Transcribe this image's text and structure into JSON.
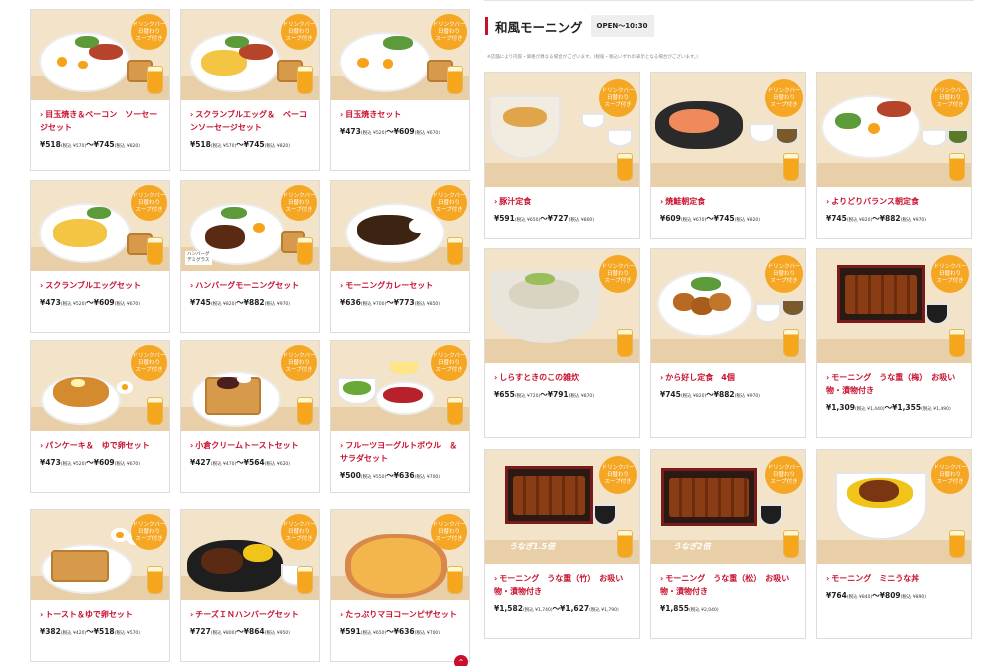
{
  "section": {
    "title": "和風モーニング",
    "hours": "OPEN〜10:30",
    "note": "※店舗により内容・価格が異なる場合がございます。(税抜・税込いずれの表示となる場合がございます。)"
  },
  "badge_text": "ドリンクバー\n日替わり\nスープ付き",
  "arrow": "›",
  "left_menu": [
    {
      "name": "目玉焼き＆ベーコン　ソーセージセット",
      "price": "¥518",
      "price_tax": "(税込 ¥570)",
      "sep": "〜",
      "price2": "¥745",
      "price2_tax": "(税込 ¥820)"
    },
    {
      "name": "スクランブルエッグ＆　ベーコンソーセージセット",
      "price": "¥518",
      "price_tax": "(税込 ¥570)",
      "sep": "〜",
      "price2": "¥745",
      "price2_tax": "(税込 ¥820)"
    },
    {
      "name": "目玉焼きセット",
      "price": "¥473",
      "price_tax": "(税込 ¥520)",
      "sep": "〜",
      "price2": "¥609",
      "price2_tax": "(税込 ¥670)"
    },
    {
      "name": "スクランブルエッグセット",
      "price": "¥473",
      "price_tax": "(税込 ¥520)",
      "sep": "〜",
      "price2": "¥609",
      "price2_tax": "(税込 ¥670)"
    },
    {
      "name": "ハンバーグモーニングセット",
      "price": "¥745",
      "price_tax": "(税込 ¥820)",
      "sep": "〜",
      "price2": "¥882",
      "price2_tax": "(税込 ¥970)"
    },
    {
      "name": "モーニングカレーセット",
      "price": "¥636",
      "price_tax": "(税込 ¥700)",
      "sep": "〜",
      "price2": "¥773",
      "price2_tax": "(税込 ¥850)"
    },
    {
      "name": "パンケーキ＆　ゆで卵セット",
      "price": "¥473",
      "price_tax": "(税込 ¥520)",
      "sep": "〜",
      "price2": "¥609",
      "price2_tax": "(税込 ¥670)"
    },
    {
      "name": "小倉クリームトーストセット",
      "price": "¥427",
      "price_tax": "(税込 ¥470)",
      "sep": "〜",
      "price2": "¥564",
      "price2_tax": "(税込 ¥620)"
    },
    {
      "name": "フルーツヨーグルトボウル　＆サラダセット",
      "price": "¥500",
      "price_tax": "(税込 ¥550)",
      "sep": "〜",
      "price2": "¥636",
      "price2_tax": "(税込 ¥700)"
    },
    {
      "name": "トースト＆ゆで卵セット",
      "price": "¥382",
      "price_tax": "(税込 ¥420)",
      "sep": "〜",
      "price2": "¥518",
      "price2_tax": "(税込 ¥570)"
    },
    {
      "name": "チーズＩＮハンバーグセット",
      "price": "¥727",
      "price_tax": "(税込 ¥800)",
      "sep": "〜",
      "price2": "¥864",
      "price2_tax": "(税込 ¥950)"
    },
    {
      "name": "たっぷりマヨコーンピザセット",
      "price": "¥591",
      "price_tax": "(税込 ¥650)",
      "sep": "〜",
      "price2": "¥636",
      "price2_tax": "(税込 ¥700)"
    }
  ],
  "right_menu": [
    {
      "name": "豚汁定食",
      "price": "¥591",
      "price_tax": "(税込 ¥650)",
      "sep": "〜",
      "price2": "¥727",
      "price2_tax": "(税込 ¥800)"
    },
    {
      "name": "焼鮭朝定食",
      "price": "¥609",
      "price_tax": "(税込 ¥670)",
      "sep": "〜",
      "price2": "¥745",
      "price2_tax": "(税込 ¥820)"
    },
    {
      "name": "よりどりバランス朝定食",
      "price": "¥745",
      "price_tax": "(税込 ¥820)",
      "sep": "〜",
      "price2": "¥882",
      "price2_tax": "(税込 ¥970)"
    },
    {
      "name": "しらすときのこの雑炊",
      "price": "¥655",
      "price_tax": "(税込 ¥720)",
      "sep": "〜",
      "price2": "¥791",
      "price2_tax": "(税込 ¥870)"
    },
    {
      "name": "から好し定食　4個",
      "price": "¥745",
      "price_tax": "(税込 ¥820)",
      "sep": "〜",
      "price2": "¥882",
      "price2_tax": "(税込 ¥970)"
    },
    {
      "name": "モーニング　うな重（梅）　お吸い物・漬物付き",
      "price": "¥1,309",
      "price_tax": "(税込 ¥1,440)",
      "sep": "〜",
      "price2": "¥1,355",
      "price2_tax": "(税込 ¥1,490)"
    },
    {
      "name": "モーニング　うな重（竹）　お吸い物・漬物付き",
      "price": "¥1,582",
      "price_tax": "(税込 ¥1,740)",
      "sep": "〜",
      "price2": "¥1,627",
      "price2_tax": "(税込 ¥1,790)"
    },
    {
      "name": "モーニング　うな重（松）　お吸い物・漬物付き",
      "price": "¥1,855",
      "price_tax": "(税込 ¥2,040)",
      "sep": "",
      "price2": "",
      "price2_tax": ""
    },
    {
      "name": "モーニング　ミニうな丼",
      "price": "¥764",
      "price_tax": "(税込 ¥840)",
      "sep": "〜",
      "price2": "¥809",
      "price2_tax": "(税込 ¥890)"
    }
  ],
  "unagi_labels": [
    "うなぎ1.5倍",
    "うなぎ2倍"
  ],
  "hamburg_label": "ハンバーグ\nデミグラス",
  "pagetop_icon": "chevron-up-icon",
  "colors": {
    "accent": "#c8102e",
    "badge": "#f5a623",
    "tile_bg": "#f3e3c9"
  }
}
